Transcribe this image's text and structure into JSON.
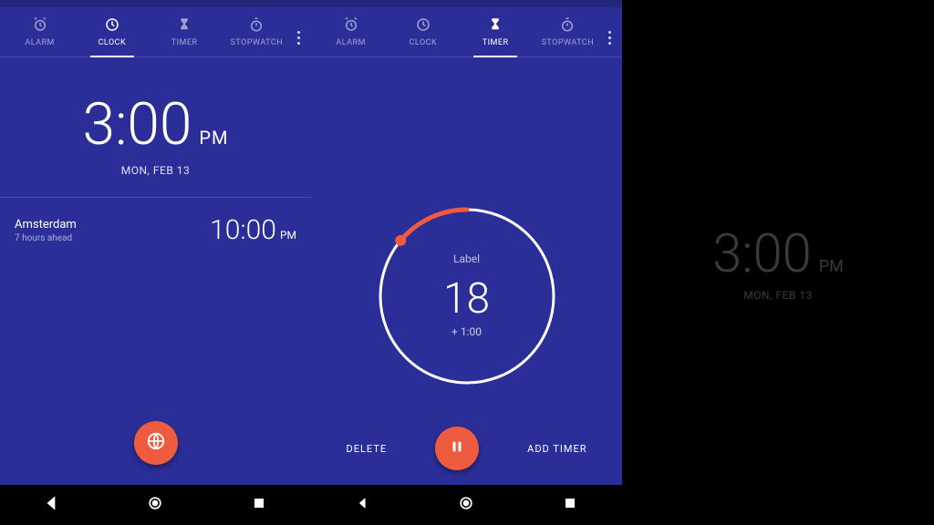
{
  "tabs": {
    "alarm": "ALARM",
    "clock": "CLOCK",
    "timer": "TIMER",
    "stopwatch": "STOPWATCH"
  },
  "clock": {
    "time": "3:00",
    "ampm": "PM",
    "date": "MON, FEB 13",
    "world": {
      "city": "Amsterdam",
      "offset": "7 hours ahead",
      "time": "10:00",
      "ampm": "PM"
    }
  },
  "timer": {
    "label": "Label",
    "value": "18",
    "extra": "+ 1:00",
    "progress_deg": 50,
    "delete": "DELETE",
    "add": "ADD TIMER"
  },
  "screensaver": {
    "time": "3:00",
    "ampm": "PM",
    "date": "MON, FEB 13"
  },
  "colors": {
    "bg": "#2b2e99",
    "accent": "#ef5b3f"
  }
}
